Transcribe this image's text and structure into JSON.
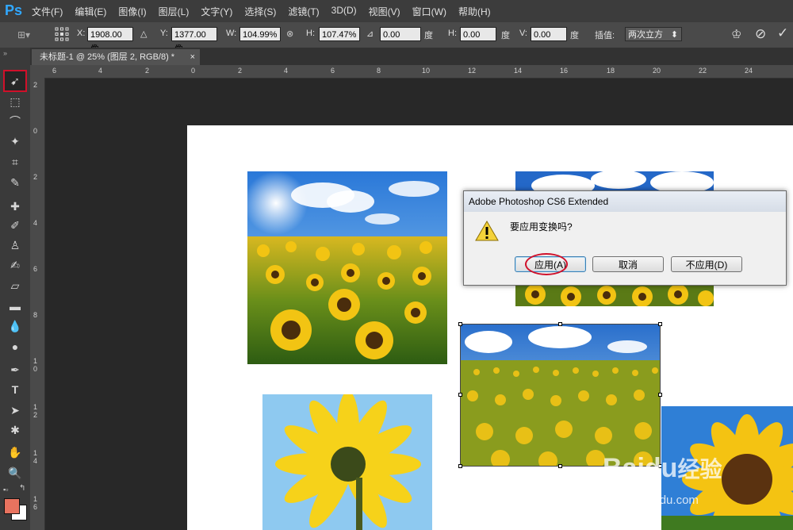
{
  "app": {
    "logo": "Ps"
  },
  "menu": [
    "文件(F)",
    "编辑(E)",
    "图像(I)",
    "图层(L)",
    "文字(Y)",
    "选择(S)",
    "滤镜(T)",
    "3D(D)",
    "视图(V)",
    "窗口(W)",
    "帮助(H)"
  ],
  "options": {
    "x_label": "X:",
    "x_value": "1908.00 像",
    "y_label": "Y:",
    "y_value": "1377.00 像",
    "w_label": "W:",
    "w_value": "104.99%",
    "h_label": "H:",
    "h_value": "107.47%",
    "angle_value": "0.00",
    "angle_unit": "度",
    "hskew_label": "H:",
    "hskew_value": "0.00",
    "hskew_unit": "度",
    "vskew_label": "V:",
    "vskew_value": "0.00",
    "vskew_unit": "度",
    "interp_label": "插值:",
    "interp_value": "两次立方"
  },
  "document": {
    "tab_title": "未标题-1 @ 25% (图层 2, RGB/8) *",
    "close": "×"
  },
  "ruler": {
    "h_ticks": [
      "6",
      "4",
      "2",
      "0",
      "2",
      "4",
      "6",
      "8",
      "10",
      "12",
      "14",
      "16",
      "18",
      "20",
      "22",
      "24"
    ],
    "v_ticks": [
      "2",
      "0",
      "2",
      "4",
      "6",
      "8",
      "1\n0",
      "1\n2",
      "1\n4",
      "1\n6"
    ]
  },
  "dialog": {
    "title": "Adobe Photoshop CS6 Extended",
    "message": "要应用变换吗?",
    "apply": "应用(A)",
    "cancel": "取消",
    "dont_apply": "不应用(D)"
  },
  "watermark": {
    "brand": "Baidu",
    "brand_cn": "经验",
    "url": "jingyan.baidu.com"
  },
  "colors": {
    "accent_ps": "#31a8ff",
    "foreground_swatch": "#e8735f",
    "highlight_red": "#d0102a"
  }
}
